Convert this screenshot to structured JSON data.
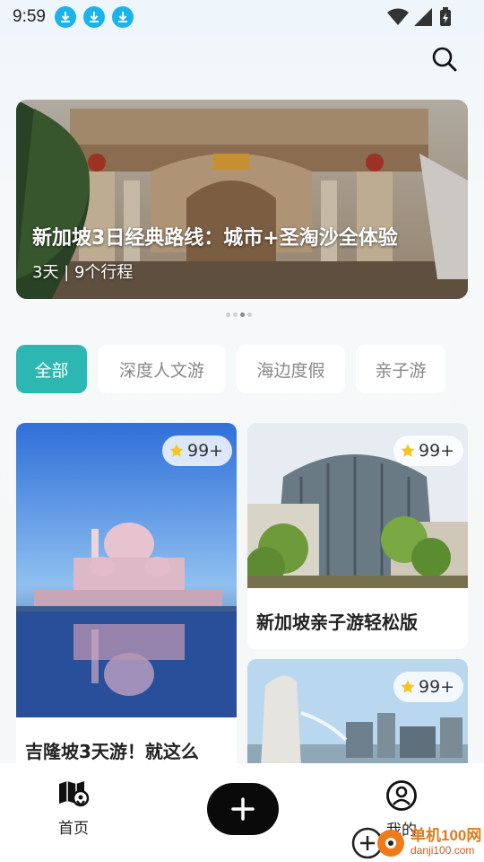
{
  "status_bar": {
    "time": "9:59",
    "download_icons": 3
  },
  "banner": {
    "title": "新加坡3日经典路线：城市+圣淘沙全体验",
    "subtitle": "3天 | 9个行程",
    "page_count": 4,
    "active_page": 3
  },
  "tabs": [
    {
      "label": "全部",
      "active": true
    },
    {
      "label": "深度人文游",
      "active": false
    },
    {
      "label": "海边度假",
      "active": false
    },
    {
      "label": "亲子游",
      "active": false
    }
  ],
  "cards": [
    {
      "title": "吉隆坡3天游！就这么",
      "rating": "99+"
    },
    {
      "title": "新加坡亲子游轻松版",
      "rating": "99+"
    },
    {
      "title": "",
      "rating": "99+"
    }
  ],
  "bottom_nav": {
    "home_label": "首页",
    "profile_label": "我的"
  },
  "watermark": {
    "name": "单机100网",
    "url": "danji100.com"
  },
  "colors": {
    "accent": "#2cb7b2",
    "download": "#19b4ec",
    "fab": "#0a0a0a",
    "star": "#f5c518"
  }
}
